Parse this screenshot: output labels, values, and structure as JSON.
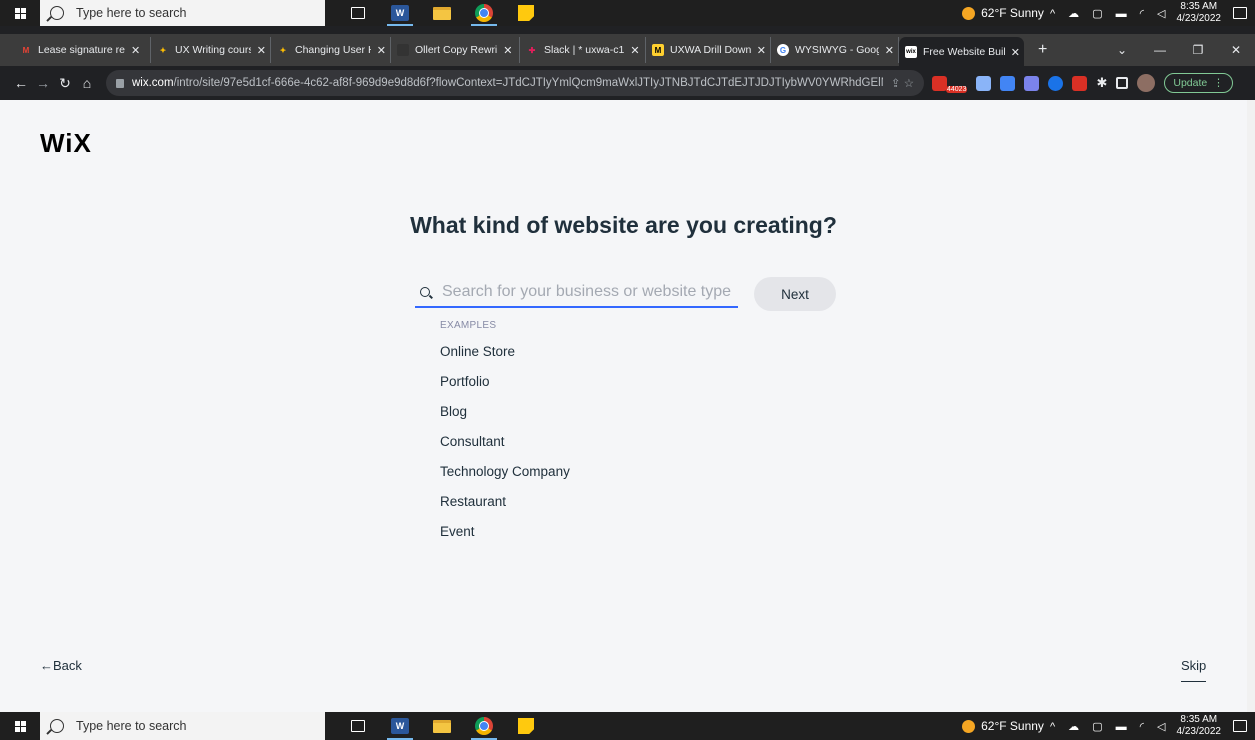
{
  "taskbar": {
    "search_placeholder": "Type here to search",
    "weather": "62°F  Sunny",
    "time": "8:35 AM",
    "date": "4/23/2022",
    "apps": [
      "task-view-icon",
      "word-icon",
      "file-explorer-icon",
      "chrome-icon",
      "sticky-notes-icon"
    ]
  },
  "browser": {
    "tabs": [
      {
        "title": "Lease signature re",
        "icon": "gmail-icon",
        "color": "#ea4335"
      },
      {
        "title": "UX Writing course",
        "icon": "spark-icon",
        "color": "#fbbc04"
      },
      {
        "title": "Changing User H",
        "icon": "spark-icon",
        "color": "#fbbc04"
      },
      {
        "title": "Ollert Copy Rewri",
        "icon": "dark-icon",
        "color": "#333333"
      },
      {
        "title": "Slack | * uxwa-c1",
        "icon": "slack-icon",
        "color": "#e01e5a"
      },
      {
        "title": "UXWA Drill Down",
        "icon": "miro-icon",
        "color": "#ffd02f"
      },
      {
        "title": "WYSIWYG - Goog",
        "icon": "google-icon",
        "color": "#ffffff"
      },
      {
        "title": "Free Website Buil",
        "icon": "wix-icon",
        "color": "#ffffff",
        "active": true
      }
    ],
    "new_tab": "+",
    "url_domain": "wix.com",
    "url_path": "/intro/site/97e5d1cf-666e-4c62-af8f-969d9e9d8d6f?flowContext=JTdCJTIyYmlQcm9maWxlJTIyJTNBJTdCJTdEJTJDJTIybWV0YWRhdGElMjIl...",
    "update_label": "Update",
    "ext_badge": "44023"
  },
  "page": {
    "logo": "WiX",
    "headline": "What kind of website are you creating?",
    "search_placeholder": "Search for your business or website type",
    "next_label": "Next",
    "examples_label": "EXAMPLES",
    "examples": [
      "Online Store",
      "Portfolio",
      "Blog",
      "Consultant",
      "Technology Company",
      "Restaurant",
      "Event"
    ],
    "back_label": "←Back",
    "skip_label": "Skip"
  }
}
